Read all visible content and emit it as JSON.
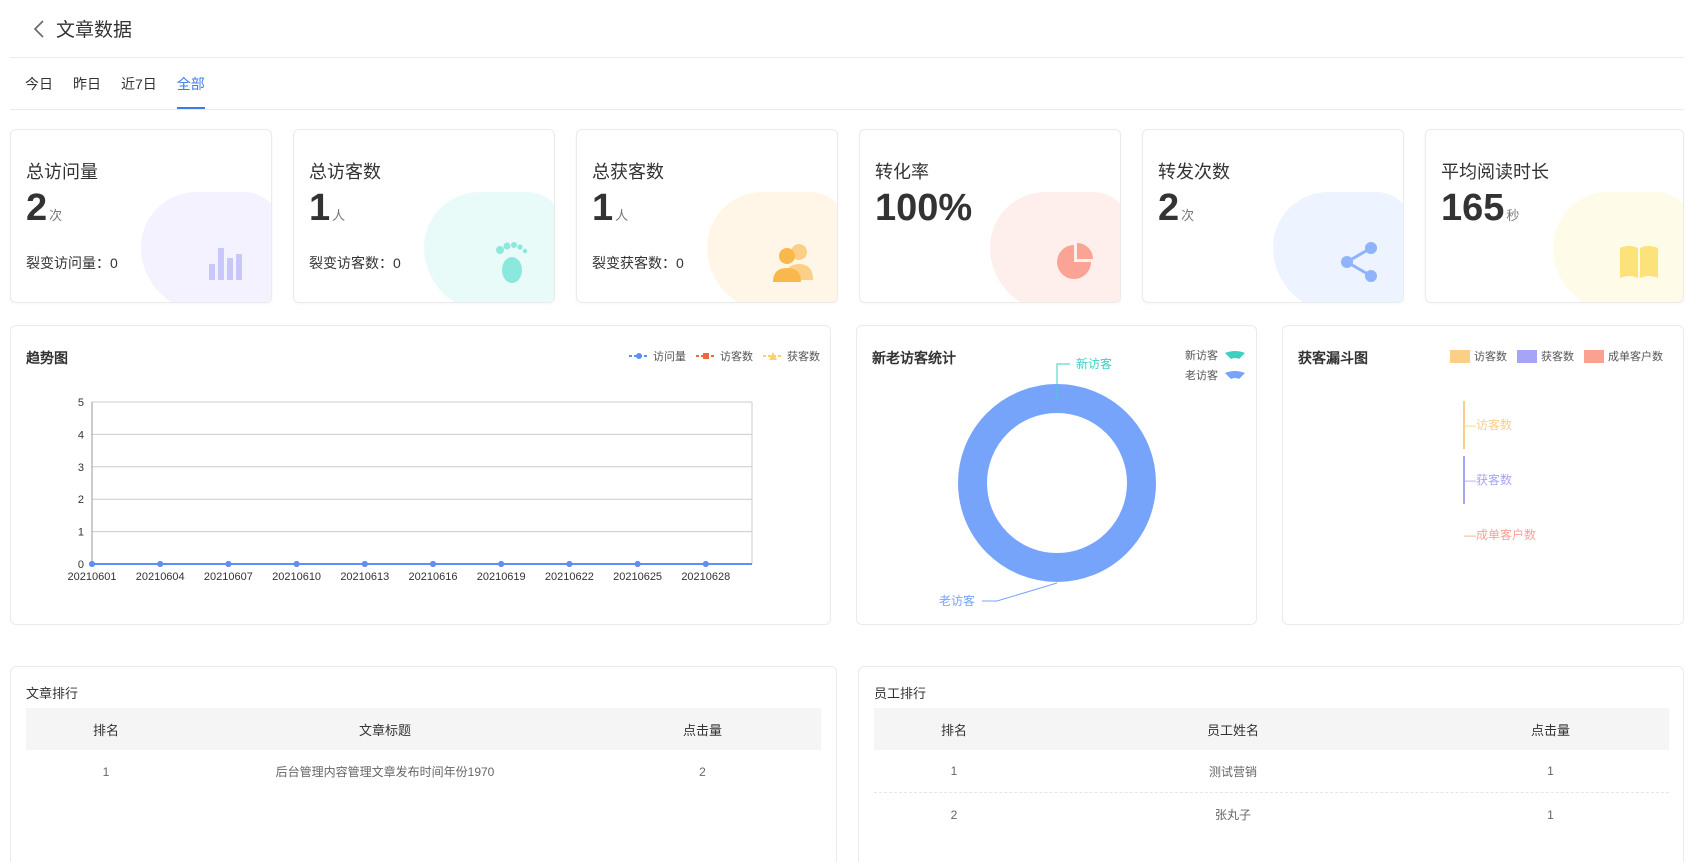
{
  "header": {
    "title": "文章数据",
    "back_icon": "chevron-left-icon"
  },
  "tabs": [
    {
      "label": "今日",
      "active": false
    },
    {
      "label": "昨日",
      "active": false
    },
    {
      "label": "近7日",
      "active": false
    },
    {
      "label": "全部",
      "active": true
    }
  ],
  "accent_color": "#3e7be8",
  "stats": [
    {
      "label": "总访问量",
      "value": "2",
      "unit": "次",
      "sub": "裂变访问量：0",
      "icon": "bar-chart-icon",
      "color": "#a9a6f5",
      "bg": "#f3f2fe"
    },
    {
      "label": "总访客数",
      "value": "1",
      "unit": "人",
      "sub": "裂变访客数：0",
      "icon": "footprint-icon",
      "color": "#6fe0d3",
      "bg": "#e9fbf8"
    },
    {
      "label": "总获客数",
      "value": "1",
      "unit": "人",
      "sub": "裂变获客数：0",
      "icon": "users-icon",
      "color": "#fbc469",
      "bg": "#fff6e7"
    },
    {
      "label": "转化率",
      "value": "100%",
      "unit": "",
      "sub": "",
      "icon": "pie-icon",
      "color": "#fba496",
      "bg": "#ffefec"
    },
    {
      "label": "转发次数",
      "value": "2",
      "unit": "次",
      "sub": "",
      "icon": "share-icon",
      "color": "#8fb4fb",
      "bg": "#edf3ff"
    },
    {
      "label": "平均阅读时长",
      "value": "165",
      "unit": "秒",
      "sub": "",
      "icon": "book-icon",
      "color": "#fde27a",
      "bg": "#fffbe9"
    }
  ],
  "trend": {
    "title": "趋势图",
    "legend": [
      "访问量",
      "访客数",
      "获客数"
    ],
    "colors": [
      "#5b8ff9",
      "#f0673b",
      "#fbd26a"
    ]
  },
  "visitors": {
    "title": "新老访客统计",
    "legend": [
      "新访客",
      "老访客"
    ],
    "colors": [
      "#3ecfc3",
      "#77a4fb"
    ],
    "label_new": "新访客",
    "label_old": "老访客"
  },
  "funnel": {
    "title": "获客漏斗图",
    "legend": [
      "访客数",
      "获客数",
      "成单客户数"
    ],
    "colors": [
      "#fbcf86",
      "#a6a4f6",
      "#fba192"
    ]
  },
  "chart_data": [
    {
      "type": "line",
      "title": "趋势图",
      "x": [
        "20210601",
        "20210604",
        "20210607",
        "20210610",
        "20210613",
        "20210616",
        "20210619",
        "20210622",
        "20210625",
        "20210628"
      ],
      "ylim": [
        0,
        5
      ],
      "yticks": [
        0,
        1,
        2,
        3,
        4,
        5
      ],
      "series": [
        {
          "name": "访问量",
          "values": [
            0,
            0,
            0,
            0,
            0,
            0,
            0,
            0,
            0,
            0
          ]
        },
        {
          "name": "访客数",
          "values": [
            0,
            0,
            0,
            0,
            0,
            0,
            0,
            0,
            0,
            0
          ]
        },
        {
          "name": "获客数",
          "values": [
            0,
            0,
            0,
            0,
            0,
            0,
            0,
            0,
            0,
            0
          ]
        }
      ],
      "legend_position": "top-right",
      "grid": true
    },
    {
      "type": "pie",
      "title": "新老访客统计",
      "categories": [
        "新访客",
        "老访客"
      ],
      "values": [
        0,
        1
      ],
      "donut": true,
      "legend_position": "top-right"
    },
    {
      "type": "bar",
      "title": "获客漏斗图",
      "categories": [
        "访客数",
        "获客数",
        "成单客户数"
      ],
      "values": [
        1,
        1,
        0
      ],
      "legend_position": "top-right"
    }
  ],
  "article_rank": {
    "title": "文章排行",
    "columns": [
      "排名",
      "文章标题",
      "点击量"
    ],
    "rows": [
      [
        "1",
        "后台管理内容管理文章发布时间年份1970",
        "2"
      ]
    ]
  },
  "staff_rank": {
    "title": "员工排行",
    "columns": [
      "排名",
      "员工姓名",
      "点击量"
    ],
    "rows": [
      [
        "1",
        "测试营销",
        "1"
      ],
      [
        "2",
        "张丸子",
        "1"
      ]
    ]
  }
}
